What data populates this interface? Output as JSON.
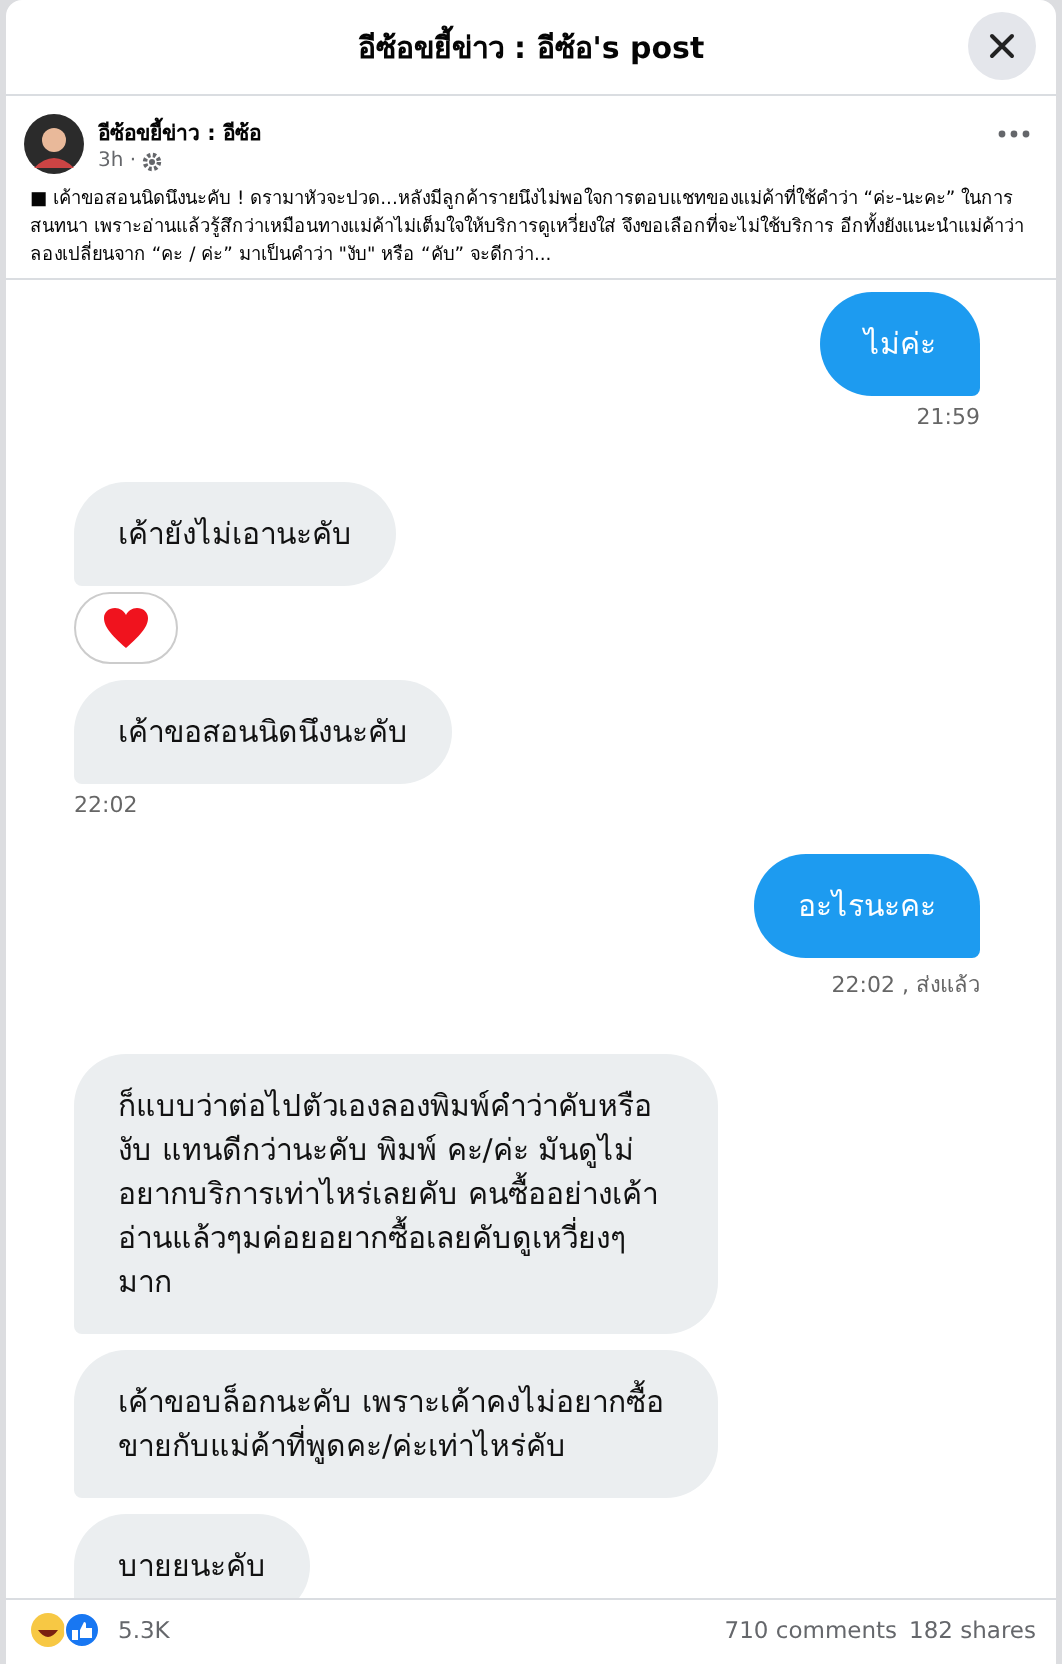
{
  "dialog": {
    "title": "อีซ้อขยี้ข่าว : อีซ้อ's post"
  },
  "post": {
    "author": "อีซ้อขยี้ข่าว : อีซ้อ",
    "time": "3h ·",
    "text": "■ เค้าขอสอนนิดนึงนะคับ ! ดรามาหัวจะปวด...หลังมีลูกค้ารายนึงไม่พอใจการตอบแชทของแม่ค้าที่ใช้คำว่า “ค่ะ-นะคะ” ในการสนทนา เพราะอ่านแล้วรู้สึกว่าเหมือนทางแม่ค้าไม่เต็มใจให้บริการดูเหวี่ยงใส่ จึงขอเลือกที่จะไม่ใช้บริการ อีกทั้งยังแนะนำแม่ค้าว่า ลองเปลี่ยนจาก “คะ / ค่ะ” มาเป็นคำว่า \"งับ\" หรือ “คับ” จะดีกว่า..."
  },
  "chat": [
    {
      "kind": "sent",
      "text": "ไม่ค่ะ",
      "time": "21:59"
    },
    {
      "kind": "received",
      "text": "เค้ายังไม่เอานะคับ"
    },
    {
      "kind": "reaction"
    },
    {
      "kind": "received",
      "text": "เค้าขอสอนนิดนึงนะคับ",
      "time": "22:02"
    },
    {
      "kind": "sent",
      "text": "อะไรนะคะ",
      "time": "22:02 , ส่งแล้ว"
    },
    {
      "kind": "received",
      "text": "ก็แบบว่าต่อไปตัวเองลองพิมพ์คำว่าคับหรืองับ แทนดีกว่านะคับ พิมพ์ คะ/ค่ะ มันดูไม่อยากบริการเท่าไหร่เลยคับ คนซื้ออย่างเค้าอ่านแล้วๆมค่อยอยากซื้อเลยคับดูเหวี่ยงๆมาก"
    },
    {
      "kind": "received",
      "text": "เค้าขอบล็อกนะคับ เพราะเค้าคงไม่อยากซื้อขายกับแม่ค้าที่พูดคะ/ค่ะเท่าไหร่คับ"
    },
    {
      "kind": "received",
      "text": "บายยนะคับ"
    }
  ],
  "stats": {
    "reactions": "5.3K",
    "comments": "710 comments",
    "shares": "182 shares"
  }
}
